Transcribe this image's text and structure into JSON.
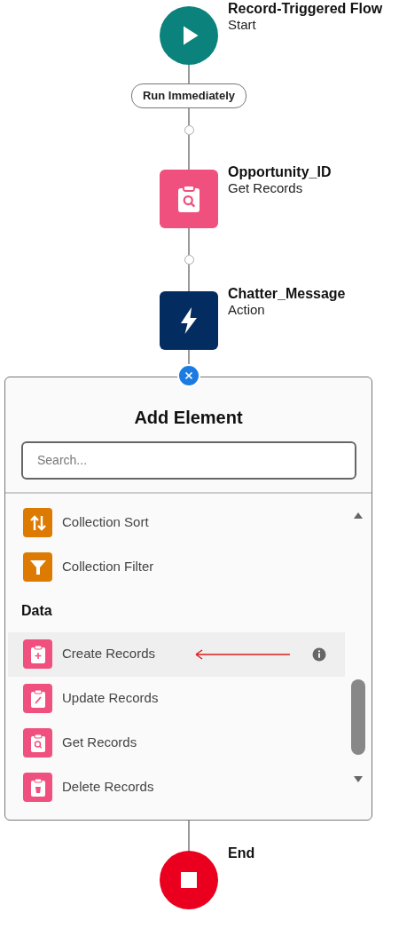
{
  "flow": {
    "start": {
      "kind": "start",
      "title": "Record-Triggered Flow",
      "subtitle": "Start"
    },
    "path_label": "Run Immediately",
    "steps": [
      {
        "kind": "get",
        "title": "Opportunity_ID",
        "subtitle": "Get Records"
      },
      {
        "kind": "action",
        "title": "Chatter_Message",
        "subtitle": "Action"
      }
    ],
    "end": {
      "kind": "end",
      "title": "End"
    }
  },
  "panel": {
    "title": "Add Element",
    "search": {
      "placeholder": "Search..."
    },
    "items": [
      {
        "kind": "sort",
        "label": "Collection Sort",
        "color": "#dd7a01",
        "selected": false
      },
      {
        "kind": "filter",
        "label": "Collection Filter",
        "color": "#dd7a01",
        "selected": false
      },
      {
        "kind": "header",
        "label": "Data"
      },
      {
        "kind": "create",
        "label": "Create Records",
        "color": "#f0507e",
        "selected": true
      },
      {
        "kind": "update",
        "label": "Update Records",
        "color": "#f0507e",
        "selected": false
      },
      {
        "kind": "get",
        "label": "Get Records",
        "color": "#f0507e",
        "selected": false
      },
      {
        "kind": "delete",
        "label": "Delete Records",
        "color": "#f0507e",
        "selected": false
      }
    ]
  }
}
